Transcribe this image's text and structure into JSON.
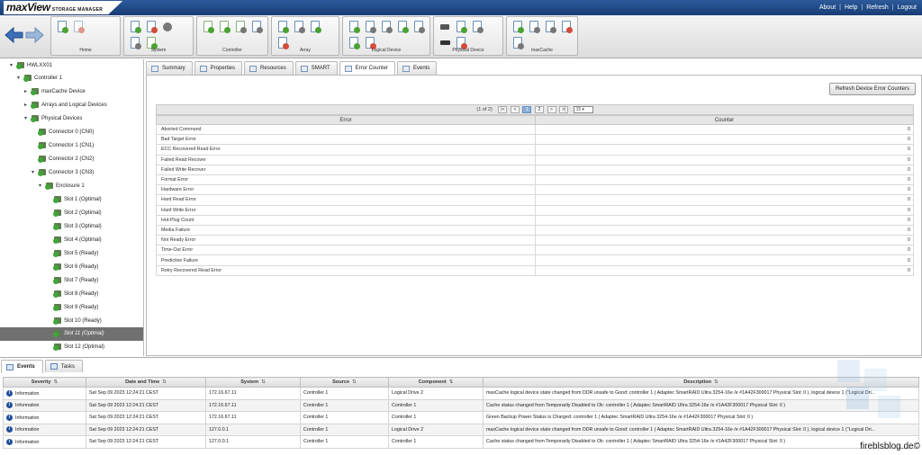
{
  "app": {
    "brand": "maxView",
    "subtitle": "STORAGE MANAGER"
  },
  "top_links": {
    "about": "About",
    "help": "Help",
    "refresh": "Refresh",
    "logout": "Logout",
    "sep": "|"
  },
  "toolbar": {
    "groups": [
      {
        "label": "Home"
      },
      {
        "label": "System"
      },
      {
        "label": "Controller"
      },
      {
        "label": "Array"
      },
      {
        "label": "Logical Device"
      },
      {
        "label": "Physical Device"
      },
      {
        "label": "maxCache"
      }
    ]
  },
  "tree": {
    "root": "HWLXX01",
    "controller": "Controller 1",
    "maxcache": "maxCache Device",
    "arrays": "Arrays and Logical Devices",
    "physical": "Physical Devices",
    "connectors": [
      "Connector 0 (CN0)",
      "Connector 1 (CN1)",
      "Connector 2 (CN2)",
      "Connector 3 (CN3)"
    ],
    "enclosure": "Enclosure 1",
    "slots": [
      "Slot 1 (Optimal)",
      "Slot 2 (Optimal)",
      "Slot 3 (Optimal)",
      "Slot 4 (Optimal)",
      "Slot 5 (Ready)",
      "Slot 6 (Ready)",
      "Slot 7 (Ready)",
      "Slot 8 (Ready)",
      "Slot 9 (Ready)",
      "Slot 10 (Ready)",
      "Slot 11 (Optimal)",
      "Slot 12 (Optimal)"
    ],
    "selected": "Slot 11 (Optimal)"
  },
  "tabs": [
    "Summary",
    "Properties",
    "Resources",
    "SMART",
    "Error Counter",
    "Events"
  ],
  "active_tab": "Error Counter",
  "refresh_button": "Refresh Device Error Counters",
  "pager": {
    "info": "(1 of 2)",
    "first": "|<",
    "prev": "<",
    "pages": [
      "1",
      "2"
    ],
    "next": ">",
    "last": ">|",
    "page_size": "15"
  },
  "error_table": {
    "headers": [
      "Error",
      "Counter"
    ],
    "rows": [
      {
        "error": "Aborted Command",
        "count": "0"
      },
      {
        "error": "Bad Target Error",
        "count": "0"
      },
      {
        "error": "ECC Recovered Read Error",
        "count": "0"
      },
      {
        "error": "Failed Read Recover",
        "count": "0"
      },
      {
        "error": "Failed Write Recover",
        "count": "0"
      },
      {
        "error": "Format Error",
        "count": "0"
      },
      {
        "error": "Hardware Error",
        "count": "0"
      },
      {
        "error": "Hard Read Error",
        "count": "0"
      },
      {
        "error": "Hard Write Error",
        "count": "0"
      },
      {
        "error": "Hot-Plug Count",
        "count": "0"
      },
      {
        "error": "Media Failure",
        "count": "0"
      },
      {
        "error": "Not Ready Error",
        "count": "0"
      },
      {
        "error": "Time-Out Error",
        "count": "0"
      },
      {
        "error": "Predictive Failure",
        "count": "0"
      },
      {
        "error": "Retry Recovered Read Error",
        "count": "0"
      }
    ]
  },
  "bottom_tabs": [
    "Events",
    "Tasks"
  ],
  "events": {
    "headers": [
      "Severity",
      "Date and Time",
      "System",
      "Source",
      "Component",
      "Description"
    ],
    "sort_glyph": "⇅",
    "rows": [
      {
        "severity": "Information",
        "date": "Sat Sep 09 2023 12:24:21 CEST",
        "system": "172.16.67.11",
        "source": "Controller 1",
        "component": "Logical Drive 2",
        "description": "maxCache logical device state changed from DDR unsafe to Good: controller 1 ( Adaptec SmartRAID Ultra 3254-16e /e #1A42F300017 Physical Slot: 0 ), logical device 1 (\"Logical Dri..."
      },
      {
        "severity": "Information",
        "date": "Sat Sep 09 2023 12:24:21 CEST",
        "system": "172.16.67.11",
        "source": "Controller 1",
        "component": "Controller 1",
        "description": "Cache status changed from Temporarily Disabled to Ok: controller 1 ( Adaptec SmartRAID Ultra 3254-16e /e #1A42F300017 Physical Slot: 0 )"
      },
      {
        "severity": "Information",
        "date": "Sat Sep 09 2023 12:24:21 CEST",
        "system": "172.16.67.11",
        "source": "Controller 1",
        "component": "Controller 1",
        "description": "Green Backup Power Status is Charged: controller 1 ( Adaptec SmartRAID Ultra 3254-16e /e #1A42F300017 Physical Slot: 0 )"
      },
      {
        "severity": "Information",
        "date": "Sat Sep 09 2023 12:24:21 CEST",
        "system": "127.0.0.1",
        "source": "Controller 1",
        "component": "Logical Drive 2",
        "description": "maxCache logical device state changed from DDR unsafe to Good: controller 1 ( Adaptec SmartRAID Ultra 3254-16e /e #1A42F300017 Physical Slot: 0 ), logical device 1 (\"Logical Dri..."
      },
      {
        "severity": "Information",
        "date": "Sat Sep 09 2023 12:24:21 CEST",
        "system": "127.0.0.1",
        "source": "Controller 1",
        "component": "Controller 1",
        "description": "Cache status changed from Temporarily Disabled to Ok: controller 1 ( Adaptec SmartRAID Ultra 3254-16e /e #1A42F300017 Physical Slot: 0 )"
      }
    ]
  },
  "watermark": "fireblsblog.de©",
  "colors": {
    "header": "#1f4a86",
    "selected": "#707070",
    "ok": "#3fa639"
  }
}
